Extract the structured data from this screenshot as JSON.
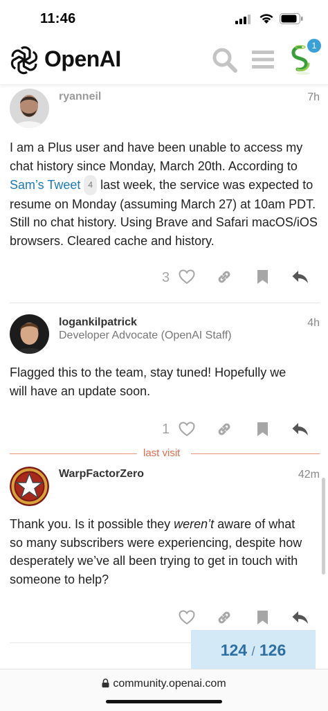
{
  "status_bar": {
    "time": "11:46"
  },
  "header": {
    "brand": "OpenAI",
    "notification_count": "1"
  },
  "posts": [
    {
      "username": "ryanneil",
      "time": "7h",
      "body_before_link": "I am a Plus user and have been unable to access my chat history since Monday, March 20th. According to ",
      "link_text": "Sam’s Tweet",
      "link_clicks": "4",
      "body_after_link": " last week, the service was expected to resume on Monday (assuming March 27) at 10am PDT. Still no chat history. Using Brave and Safari macOS/iOS browsers. Cleared cache and history.",
      "likes": "3"
    },
    {
      "username": "logankilpatrick",
      "user_title": "Developer Advocate (OpenAI Staff)",
      "time": "4h",
      "body_line1": "Flagged this to the team, stay tuned! Hopefully we",
      "body_line2": "will have an update soon.",
      "likes": "1"
    },
    {
      "username": "WarpFactorZero",
      "time": "42m",
      "body_line1_pre": "Thank you. Is it possible they ",
      "body_line1_em": "weren’t",
      "body_line1_post": " aware of what",
      "body_line2": "so many subscribers were experiencing, despite how",
      "body_line3": "desperately we’ve all been trying to get in touch with",
      "body_line4": "someone to help?"
    }
  ],
  "last_visit_label": "last visit",
  "progress": {
    "current": "124",
    "separator": "/",
    "total": "126"
  },
  "browser": {
    "url": "community.openai.com"
  },
  "colors": {
    "link": "#1c7bb6",
    "accent": "#e06c4e",
    "progress_bg": "#d4e9f6"
  },
  "icons": [
    "search-icon",
    "hamburger-menu-icon",
    "heart-icon",
    "link-icon",
    "bookmark-icon",
    "reply-icon",
    "lock-icon"
  ]
}
